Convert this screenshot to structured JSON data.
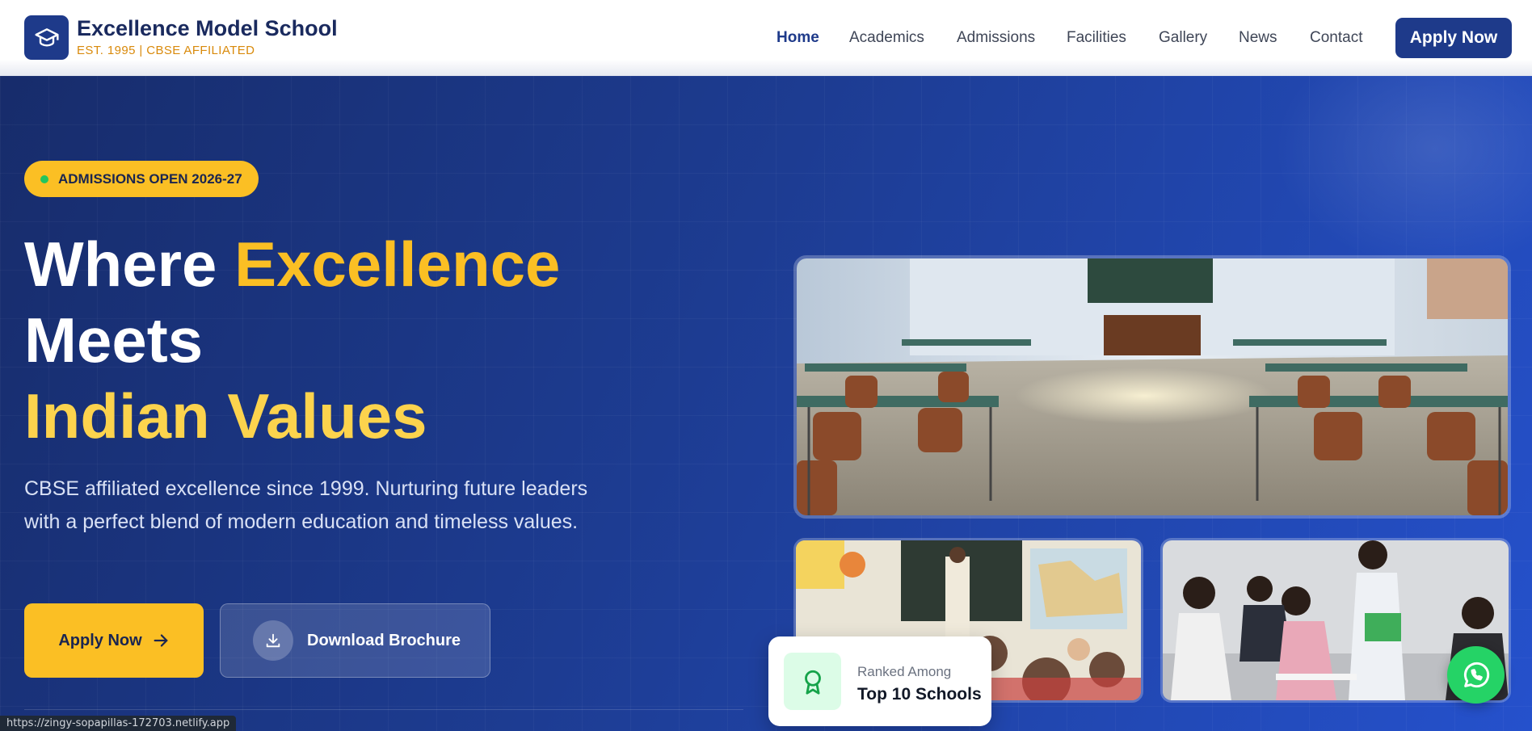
{
  "brand": {
    "name": "Excellence Model School",
    "tagline": "EST. 1995 | CBSE AFFILIATED",
    "logo_icon": "graduation-cap-icon"
  },
  "nav": {
    "items": [
      {
        "label": "Home",
        "active": true
      },
      {
        "label": "Academics",
        "active": false
      },
      {
        "label": "Admissions",
        "active": false
      },
      {
        "label": "Facilities",
        "active": false
      },
      {
        "label": "Gallery",
        "active": false
      },
      {
        "label": "News",
        "active": false
      },
      {
        "label": "Contact",
        "active": false
      }
    ],
    "cta_label": "Apply Now"
  },
  "hero": {
    "badge": "ADMISSIONS OPEN 2026-27",
    "headline": {
      "part1": "Where ",
      "part2": "Excellence",
      "part3": "Meets",
      "part4": "Indian Values"
    },
    "description": "CBSE affiliated excellence since 1999. Nurturing future leaders with a perfect blend of modern education and timeless values.",
    "primary_button": "Apply Now",
    "secondary_button": "Download Brochure"
  },
  "gallery": {
    "main_image": "empty-classroom-photo",
    "small_image_1": "classroom-teacher-students-photo",
    "small_image_2": "students-studying-photo"
  },
  "rank_card": {
    "label": "Ranked Among",
    "value": "Top 10 Schools",
    "icon": "award-ribbon-icon"
  },
  "whatsapp": {
    "icon": "whatsapp-icon"
  },
  "status_bar": {
    "url": "https://zingy-sopapillas-172703.netlify.app"
  },
  "colors": {
    "primary": "#1e3a8a",
    "accent": "#fbbf24",
    "tagline": "#d98a0b",
    "whatsapp": "#25d366"
  }
}
